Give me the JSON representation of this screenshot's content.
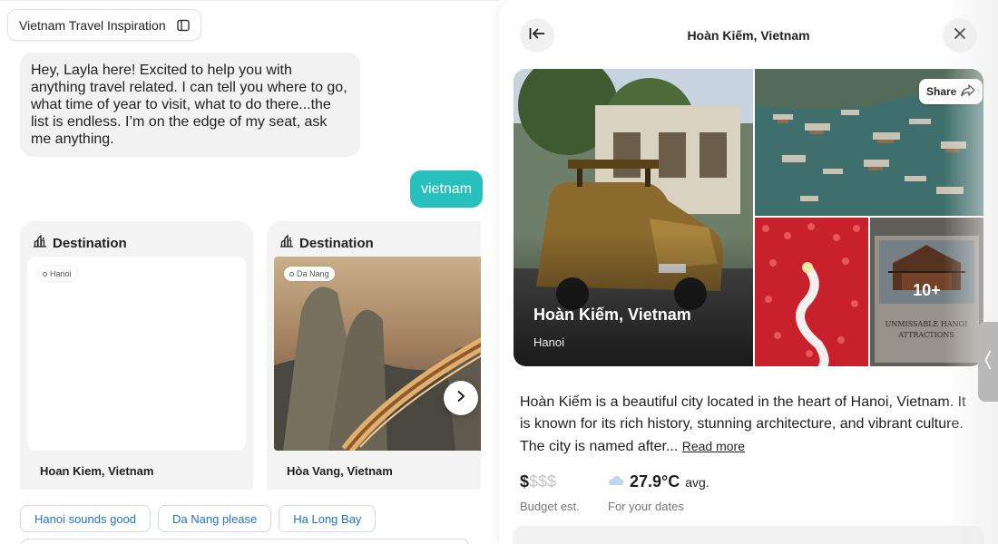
{
  "chat": {
    "title": "Vietnam Travel Inspiration",
    "bot_message": "Hey, Layla here! Excited to help you with anything travel related. I can tell you where to go, what time of year to visit, what to do there...the list is endless. I’m on the edge of my seat, ask me anything.",
    "user_message": "vietnam",
    "cards": [
      {
        "header": "Destination",
        "location_tag": "Hanoi",
        "name": "Hoan Kiem, Vietnam"
      },
      {
        "header": "Destination",
        "location_tag": "Da Nang",
        "name": "Hòa Vang, Vietnam"
      }
    ],
    "suggestions": [
      "Hanoi sounds good",
      "Da Nang please",
      "Ha Long Bay"
    ]
  },
  "detail": {
    "title": "Hoàn Kiếm, Vietnam",
    "gallery": {
      "main_title": "Hoàn Kiếm, Vietnam",
      "main_subtitle": "Hanoi",
      "share_label": "Share",
      "more_label": "10+"
    },
    "description": "Hoàn Kiếm is a beautiful city located in the heart of Hanoi, Vietnam. It is known for its rich history, stunning architecture, and vibrant culture. The city is named after...",
    "read_more": "Read more",
    "budget": {
      "active": "$",
      "inactive": "$$$",
      "label": "Budget est."
    },
    "weather": {
      "value": "27.9°C",
      "suffix": "avg.",
      "label": "For your dates"
    }
  },
  "colors": {
    "accent": "#27c0bd",
    "link": "#1e74c6"
  },
  "icons": [
    "sidebar-toggle-icon",
    "skyline-icon",
    "location-pin-icon",
    "chevron-right-icon",
    "back-arrow-icon",
    "close-icon",
    "share-icon",
    "cloud-icon",
    "chevron-left-icon"
  ]
}
